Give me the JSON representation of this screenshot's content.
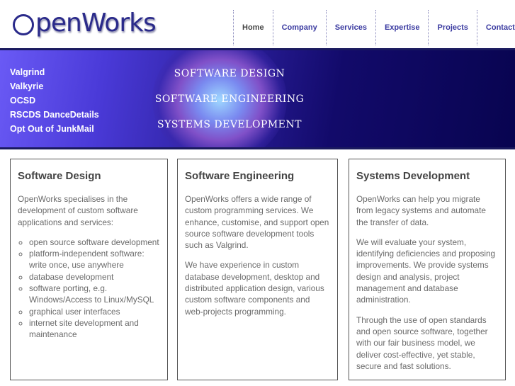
{
  "logo": {
    "text": "OpenWorks",
    "rest": "penWorks"
  },
  "nav": [
    {
      "label": "Home"
    },
    {
      "label": "Company"
    },
    {
      "label": "Services"
    },
    {
      "label": "Expertise"
    },
    {
      "label": "Projects"
    },
    {
      "label": "Contact"
    }
  ],
  "banner": {
    "links": [
      "Valgrind",
      "Valkyrie",
      "OCSD",
      "RSCDS DanceDetails",
      "Opt Out of JunkMail"
    ],
    "taglines": [
      "Software Design",
      "Software Engineering",
      "Systems Development"
    ]
  },
  "boxes": [
    {
      "title": "Software Design",
      "paragraphs": [
        "OpenWorks specialises in the development of custom software applications and services:"
      ],
      "list": [
        "open source software development",
        "platform-independent software: write once, use anywhere",
        "database development",
        "software porting, e.g. Windows/Access to Linux/MySQL",
        "graphical user interfaces",
        "internet site development and maintenance"
      ]
    },
    {
      "title": "Software Engineering",
      "paragraphs": [
        "OpenWorks offers a wide range of custom programming services. We enhance, customise, and support open source software development tools such as Valgrind.",
        "We have experience in custom database development, desktop and distributed application design, various custom software components and web-projects programming."
      ]
    },
    {
      "title": "Systems Development",
      "paragraphs": [
        "OpenWorks can help you migrate from legacy systems and automate the transfer of data.",
        "We will evaluate your system, identifying deficiencies and proposing improvements. We provide systems design and analysis, project management and database administration.",
        "Through the use of open standards and open source software, together with our fair business model, we deliver cost-effective, yet stable, secure and fast solutions."
      ]
    }
  ]
}
